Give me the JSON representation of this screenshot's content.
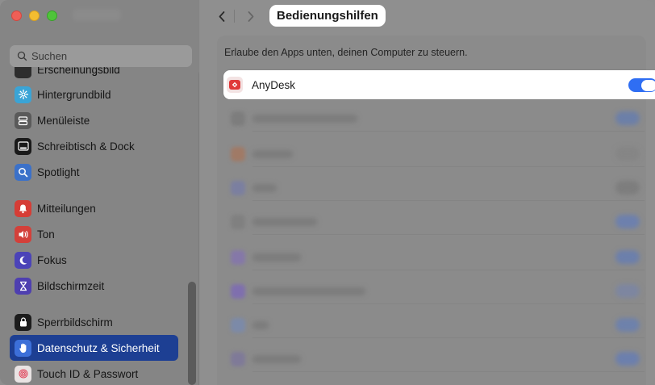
{
  "sidebar": {
    "search_placeholder": "Suchen",
    "items": [
      {
        "label": "Erscheinungsbild",
        "icon": "appearance-icon",
        "color": "#2d2d2d",
        "top": 0
      },
      {
        "label": "Hintergrundbild",
        "icon": "wallpaper-icon",
        "color": "#3aa4d6",
        "top": 0
      },
      {
        "label": "Menüleiste",
        "icon": "menubar-icon",
        "color": "#5a5a5a",
        "top": 0
      },
      {
        "label": "Schreibtisch & Dock",
        "icon": "dock-icon",
        "color": "#1a1a1a",
        "top": 0
      },
      {
        "label": "Spotlight",
        "icon": "spotlight-icon",
        "color": "#3b71c9",
        "top": 0
      },
      {
        "label": "Mitteilungen",
        "icon": "notifications-icon",
        "color": "#d63d36",
        "top": 0
      },
      {
        "label": "Ton",
        "icon": "sound-icon",
        "color": "#d3403a",
        "top": 0
      },
      {
        "label": "Fokus",
        "icon": "focus-icon",
        "color": "#4b43b8",
        "top": 0
      },
      {
        "label": "Bildschirmzeit",
        "icon": "screentime-icon",
        "color": "#4e3fb0",
        "top": 0
      },
      {
        "label": "Sperrbildschirm",
        "icon": "lockscreen-icon",
        "color": "#1c1c1c",
        "top": 0
      },
      {
        "label": "Datenschutz & Sicherheit",
        "icon": "privacy-hand-icon",
        "color": "#3c6fd8",
        "top": 0,
        "selected": true
      },
      {
        "label": "Touch ID & Passwort",
        "icon": "touchid-icon",
        "color": "#e9e3e3",
        "top": 0
      }
    ]
  },
  "main": {
    "title": "Bedienungshilfen",
    "hint": "Erlaube den Apps unten, deinen Computer zu steuern.",
    "app": {
      "name": "AnyDesk",
      "icon": "anydesk-icon",
      "enabled": true,
      "accent": "#e03a3a"
    },
    "toggle_color": "#2f6ef3"
  }
}
